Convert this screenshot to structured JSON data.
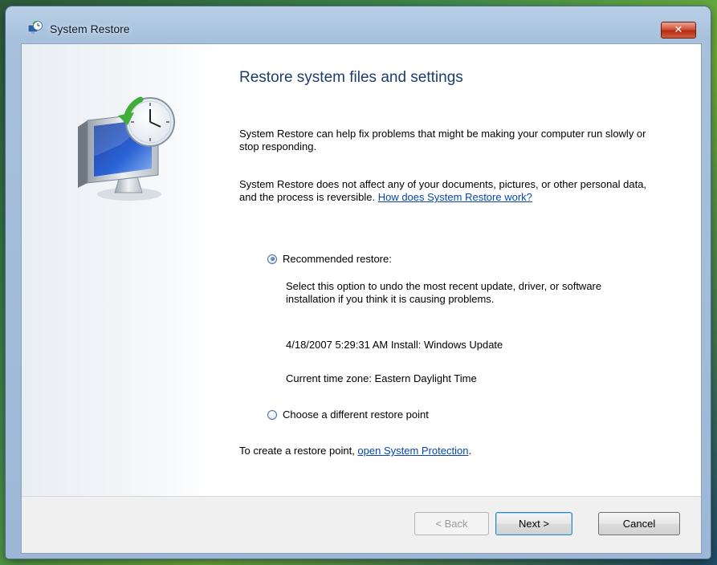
{
  "window": {
    "title": "System Restore",
    "close_label": "✕"
  },
  "content": {
    "heading": "Restore system files and settings",
    "para1": "System Restore can help fix problems that might be making your computer run slowly or stop responding.",
    "para2_text": "System Restore does not affect any of your documents, pictures, or other personal data, and the process is reversible. ",
    "para2_link": "How does System Restore work?",
    "recommended": {
      "label": "Recommended restore:",
      "selected": true,
      "description": "Select this option to undo the most recent update, driver, or software installation if you think it is causing problems.",
      "restore_point": "4/18/2007 5:29:31 AM Install: Windows Update",
      "time_zone": "Current time zone: Eastern Daylight Time"
    },
    "different": {
      "label": "Choose a different restore point",
      "selected": false
    },
    "create_text": "To create a restore point, ",
    "create_link": "open System Protection",
    "create_end": "."
  },
  "footer": {
    "back_label": "< Back",
    "next_label": "Next >",
    "cancel_label": "Cancel"
  },
  "icons": {
    "title": "system-restore-icon",
    "hero": "monitor-clock-restore-icon"
  }
}
